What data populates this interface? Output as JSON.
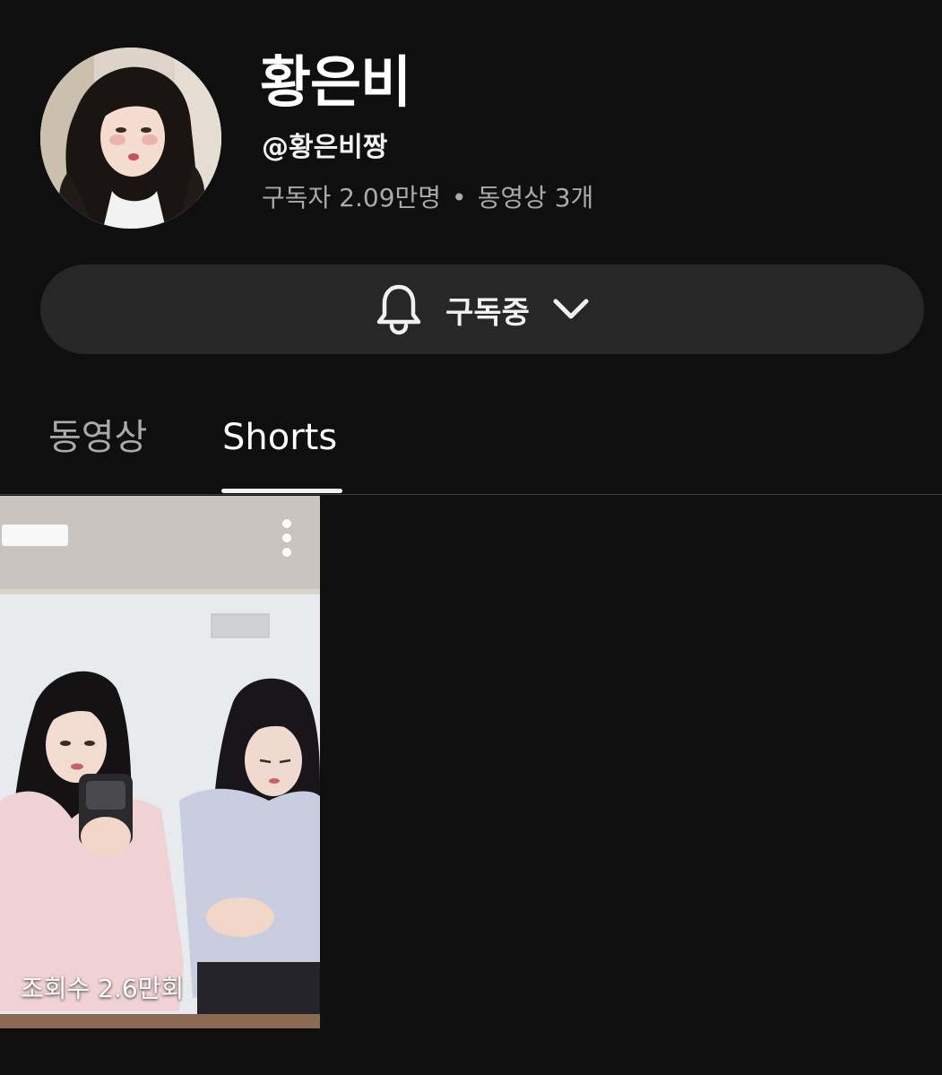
{
  "channel": {
    "name": "황은비",
    "handle": "@황은비짱",
    "subscribers": "구독자 2.09만명",
    "separator": "•",
    "video_count": "동영상 3개",
    "avatar_icon": "channel-avatar"
  },
  "subscribe_button": {
    "label": "구독중",
    "icon": "bell-icon",
    "chevron": "chevron-down-icon"
  },
  "tabs": [
    {
      "label": "동영상",
      "selected": false
    },
    {
      "label": "Shorts",
      "selected": true
    }
  ],
  "shorts": [
    {
      "views": "조회수 2.6만회",
      "menu_icon": "more-vert-icon"
    }
  ],
  "colors": {
    "background": "#0f0f0f",
    "pill": "#272727",
    "secondary_text": "#aaaaaa",
    "primary_text": "#f1f1f1"
  }
}
